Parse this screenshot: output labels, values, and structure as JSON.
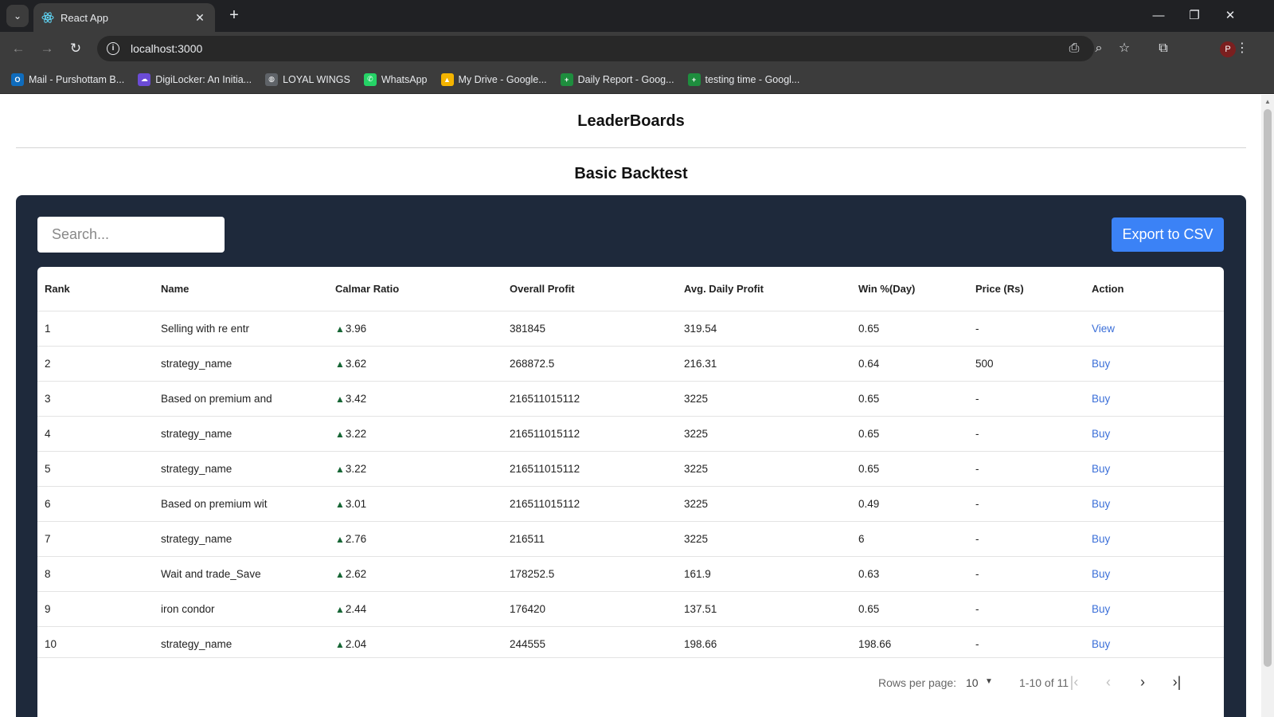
{
  "browser": {
    "tab_title": "React App",
    "url": "localhost:3000",
    "profile_initial": "P",
    "bookmarks": [
      {
        "label": "Mail - Purshottam B...",
        "color": "#0f6cbd",
        "glyph": "O"
      },
      {
        "label": "DigiLocker: An Initia...",
        "color": "#6b4bd6",
        "glyph": "☁"
      },
      {
        "label": "LOYAL WINGS",
        "color": "#5f6368",
        "glyph": "◍"
      },
      {
        "label": "WhatsApp",
        "color": "#25d366",
        "glyph": "✆"
      },
      {
        "label": "My Drive - Google...",
        "color": "#f4b400",
        "glyph": "▲"
      },
      {
        "label": "Daily Report - Goog...",
        "color": "#1e8e3e",
        "glyph": "+"
      },
      {
        "label": "testing time - Googl...",
        "color": "#1e8e3e",
        "glyph": "+"
      }
    ]
  },
  "page": {
    "title": "LeaderBoards",
    "section_title": "Basic Backtest",
    "search_placeholder": "Search...",
    "export_label": "Export to CSV"
  },
  "table": {
    "columns": [
      "Rank",
      "Name",
      "Calmar Ratio",
      "Overall Profit",
      "Avg. Daily Profit",
      "Win %(Day)",
      "Price (Rs)",
      "Action"
    ],
    "rows": [
      {
        "rank": "1",
        "name": "Selling with re entr",
        "calmar": "3.96",
        "profit": "381845",
        "avg": "319.54",
        "win": "0.65",
        "price": "-",
        "action": "View"
      },
      {
        "rank": "2",
        "name": "strategy_name",
        "calmar": "3.62",
        "profit": "268872.5",
        "avg": "216.31",
        "win": "0.64",
        "price": "500",
        "action": "Buy"
      },
      {
        "rank": "3",
        "name": "Based on premium and",
        "calmar": "3.42",
        "profit": "216511015112",
        "avg": "3225",
        "win": "0.65",
        "price": "-",
        "action": "Buy"
      },
      {
        "rank": "4",
        "name": "strategy_name",
        "calmar": "3.22",
        "profit": "216511015112",
        "avg": "3225",
        "win": "0.65",
        "price": "-",
        "action": "Buy"
      },
      {
        "rank": "5",
        "name": "strategy_name",
        "calmar": "3.22",
        "profit": "216511015112",
        "avg": "3225",
        "win": "0.65",
        "price": "-",
        "action": "Buy"
      },
      {
        "rank": "6",
        "name": "Based on premium wit",
        "calmar": "3.01",
        "profit": "216511015112",
        "avg": "3225",
        "win": "0.49",
        "price": "-",
        "action": "Buy"
      },
      {
        "rank": "7",
        "name": "strategy_name",
        "calmar": "2.76",
        "profit": "216511",
        "avg": "3225",
        "win": "6",
        "price": "-",
        "action": "Buy"
      },
      {
        "rank": "8",
        "name": "Wait and trade_Save",
        "calmar": "2.62",
        "profit": "178252.5",
        "avg": "161.9",
        "win": "0.63",
        "price": "-",
        "action": "Buy"
      },
      {
        "rank": "9",
        "name": "iron condor",
        "calmar": "2.44",
        "profit": "176420",
        "avg": "137.51",
        "win": "0.65",
        "price": "-",
        "action": "Buy"
      },
      {
        "rank": "10",
        "name": "strategy_name",
        "calmar": "2.04",
        "profit": "244555",
        "avg": "198.66",
        "win": "198.66",
        "price": "-",
        "action": "Buy"
      }
    ]
  },
  "pagination": {
    "rows_per_page_label": "Rows per page:",
    "rows_per_page_value": "10",
    "range_label": "1-10 of 11"
  }
}
